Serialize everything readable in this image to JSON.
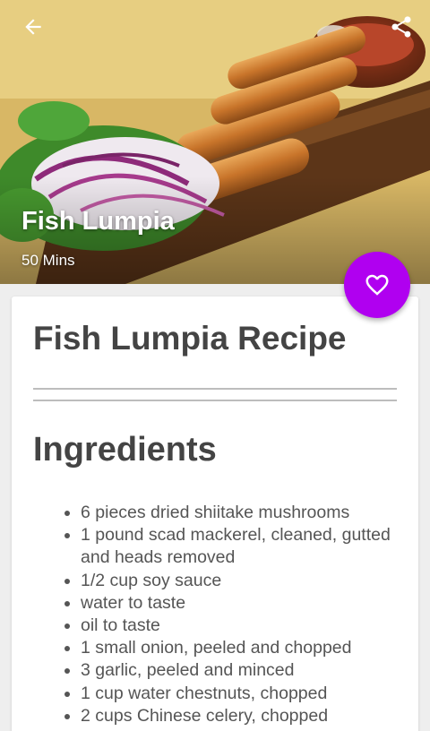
{
  "header": {
    "back_icon": "arrow-left-icon",
    "share_icon": "share-icon"
  },
  "hero": {
    "title": "Fish Lumpia",
    "time": "50 Mins"
  },
  "favorite": {
    "icon": "heart-icon",
    "color": "#b000f0"
  },
  "recipe": {
    "title": "Fish Lumpia Recipe",
    "ingredients_heading": "Ingredients",
    "ingredients": [
      "6 pieces dried shiitake mushrooms",
      "1 pound scad mackerel, cleaned, gutted and heads removed",
      "1/2 cup soy sauce",
      "water to taste",
      "oil to taste",
      "1 small onion, peeled and chopped",
      "3 garlic, peeled and minced",
      "1 cup water chestnuts, chopped",
      "2 cups Chinese celery, chopped"
    ]
  }
}
